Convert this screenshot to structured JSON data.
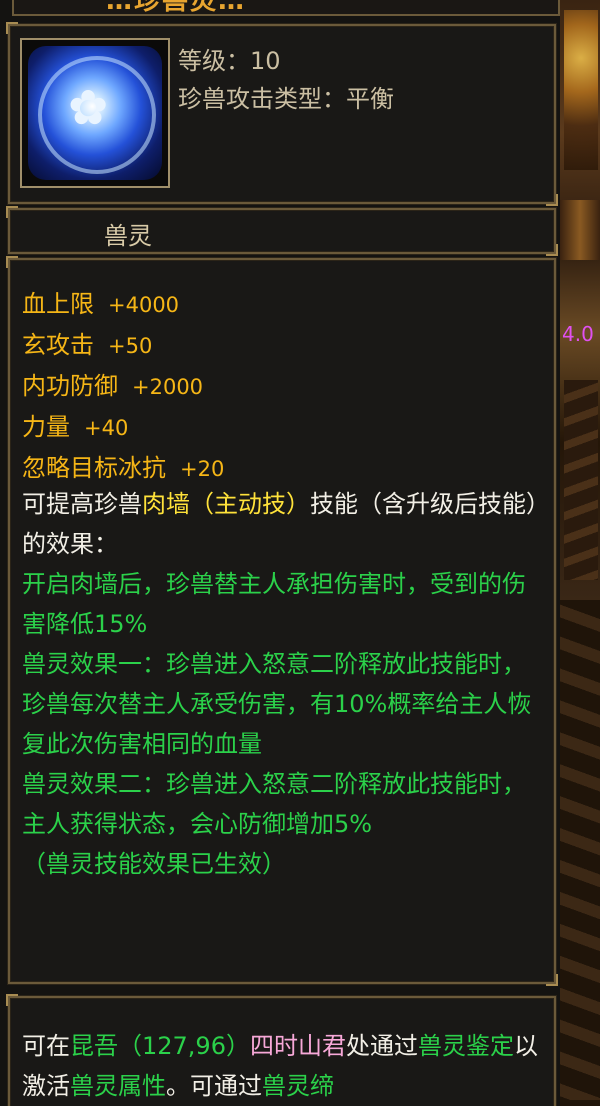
{
  "title_partial": "…珍兽灵…",
  "header": {
    "icon": "blue-flower-orb-icon",
    "level_label": "等级：10",
    "type_label": "珍兽攻击类型：平衡"
  },
  "name": "兽灵",
  "stats": [
    {
      "label": "血上限",
      "value": "+4000"
    },
    {
      "label": "玄攻击",
      "value": "+50"
    },
    {
      "label": "内功防御",
      "value": "+2000"
    },
    {
      "label": "力量",
      "value": "+40"
    },
    {
      "label": "忽略目标冰抗",
      "value": "+20"
    }
  ],
  "skill_intro": {
    "pre": "可提高珍兽",
    "skill": "肉墙（主动技）",
    "post": "技能（含升级后技能）的效果："
  },
  "effects": [
    "开启肉墙后，珍兽替主人承担伤害时，受到的伤害降低15%",
    "兽灵效果一：珍兽进入怒意二阶释放此技能时，珍兽每次替主人承受伤害，有10%概率给主人恢复此次伤害相同的血量",
    "兽灵效果二：珍兽进入怒意二阶释放此技能时，主人获得状态，会心防御增加5%",
    "（兽灵技能效果已生效）"
  ],
  "bottom": {
    "p1": "可在",
    "place": "昆吾（127,96）",
    "npc": "四时山君",
    "p2": "处通过",
    "action": "兽灵鉴定",
    "p3": "以激活",
    "attr": "兽灵属性",
    "p4": "。可通过",
    "more": "兽灵缔"
  },
  "side_number": "4.0",
  "colors": {
    "stat": "#f6b616",
    "green": "#2bd14a",
    "yellow": "#ffe23a",
    "pink": "#f7a8d8",
    "frame": "#6b5a3a"
  }
}
